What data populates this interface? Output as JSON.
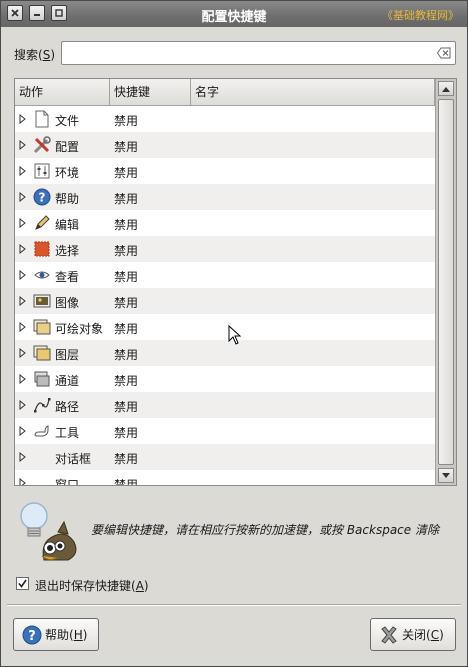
{
  "window": {
    "title": "配置快捷键",
    "watermark": "《基础教程网》"
  },
  "search": {
    "label_main": "搜索(",
    "label_key": "S",
    "label_end": ")",
    "value": "",
    "placeholder": ""
  },
  "table": {
    "columns": [
      "动作",
      "快捷键",
      "名字"
    ],
    "rows": [
      {
        "icon": "file-icon",
        "name": "文件",
        "shortcut": "禁用"
      },
      {
        "icon": "tools-config-icon",
        "name": "配置",
        "shortcut": "禁用"
      },
      {
        "icon": "environment-icon",
        "name": "环境",
        "shortcut": "禁用"
      },
      {
        "icon": "help-icon",
        "name": "帮助",
        "shortcut": "禁用"
      },
      {
        "icon": "edit-pencil-icon",
        "name": "编辑",
        "shortcut": "禁用"
      },
      {
        "icon": "select-icon",
        "name": "选择",
        "shortcut": "禁用"
      },
      {
        "icon": "view-eye-icon",
        "name": "查看",
        "shortcut": "禁用"
      },
      {
        "icon": "image-icon",
        "name": "图像",
        "shortcut": "禁用"
      },
      {
        "icon": "drawable-icon",
        "name": "可绘对象",
        "shortcut": "禁用"
      },
      {
        "icon": "layer-icon",
        "name": "图层",
        "shortcut": "禁用"
      },
      {
        "icon": "channel-icon",
        "name": "通道",
        "shortcut": "禁用"
      },
      {
        "icon": "path-icon",
        "name": "路径",
        "shortcut": "禁用"
      },
      {
        "icon": "tools-icon",
        "name": "工具",
        "shortcut": "禁用"
      },
      {
        "icon": "",
        "name": "对话框",
        "shortcut": "禁用"
      },
      {
        "icon": "",
        "name": "窗口",
        "shortcut": "禁用"
      }
    ]
  },
  "hint": {
    "text": "要编辑快捷键，请在相应行按新的加速键，或按 Backspace 清除"
  },
  "save_on_exit": {
    "label": "退出时保存快捷键(",
    "key": "A",
    "end": ")",
    "checked": true
  },
  "buttons": {
    "help_main": "帮助(",
    "help_key": "H",
    "help_end": ")",
    "close_main": "关闭(",
    "close_key": "C",
    "close_end": ")"
  }
}
